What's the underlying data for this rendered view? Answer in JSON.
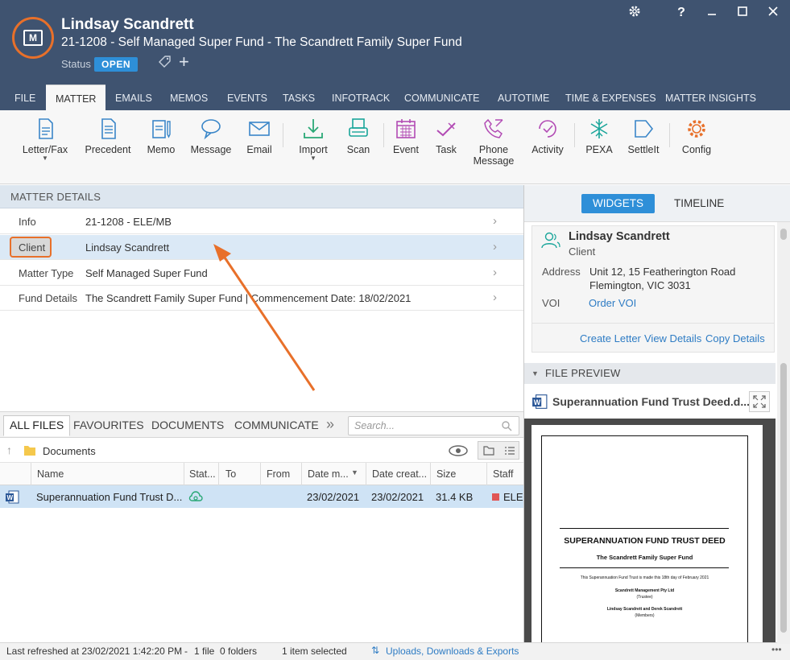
{
  "window": {
    "client_name": "Lindsay Scandrett",
    "matter_line": "21-1208 - Self Managed Super Fund - The Scandrett Family Super Fund",
    "status_label": "Status",
    "status_value": "OPEN",
    "logo_letter": "M",
    "controls": [
      "gear",
      "help",
      "minimize",
      "maximize",
      "close"
    ]
  },
  "tabs": [
    "FILE",
    "MATTER",
    "EMAILS",
    "MEMOS",
    "EVENTS",
    "TASKS",
    "INFOTRACK",
    "COMMUNICATE",
    "AUTOTIME",
    "TIME & EXPENSES",
    "MATTER INSIGHTS"
  ],
  "ribbon": {
    "letter_fax": "Letter/Fax",
    "precedent": "Precedent",
    "memo": "Memo",
    "message": "Message",
    "email": "Email",
    "import": "Import",
    "scan": "Scan",
    "event": "Event",
    "task": "Task",
    "phone_message_1": "Phone",
    "phone_message_2": "Message",
    "activity": "Activity",
    "pexa": "PEXA",
    "settleit": "SettleIt",
    "config": "Config"
  },
  "matter_details": {
    "header": "MATTER DETAILS",
    "rows": [
      {
        "label": "Info",
        "value": "21-1208 - ELE/MB"
      },
      {
        "label": "Client",
        "value": "Lindsay Scandrett"
      },
      {
        "label": "Matter Type",
        "value": "Self Managed Super Fund"
      },
      {
        "label": "Fund Details",
        "value": "The Scandrett Family Super Fund | Commencement Date: 18/02/2021"
      }
    ]
  },
  "files": {
    "tabs": [
      "ALL FILES",
      "FAVOURITES",
      "DOCUMENTS",
      "COMMUNICATE"
    ],
    "search_placeholder": "Search...",
    "folder": "Documents",
    "columns": [
      "Name",
      "Stat...",
      "To",
      "From",
      "Date m...",
      "Date creat...",
      "Size",
      "Staff"
    ],
    "rows": [
      {
        "name": "Superannuation Fund Trust D...",
        "to": "",
        "from": "",
        "date_modified": "23/02/2021",
        "date_created": "23/02/2021",
        "size": "31.4 KB",
        "staff": "ELE"
      }
    ]
  },
  "status_bar": {
    "refreshed": "Last refreshed at 23/02/2021 1:42:20 PM",
    "sep": "-",
    "file_count": "1 file",
    "folder_count": "0 folders",
    "selected": "1 item selected",
    "uploads": "Uploads, Downloads & Exports"
  },
  "right_panel": {
    "tab_widgets": "WIDGETS",
    "tab_timeline": "TIMELINE",
    "contact_name": "Lindsay Scandrett",
    "contact_role": "Client",
    "address_label": "Address",
    "address_line1": "Unit 12, 15 Featherington Road",
    "address_line2": "Flemington, VIC 3031",
    "voi_label": "VOI",
    "voi_link": "Order VOI",
    "create_letter": "Create Letter",
    "view_details": "View Details",
    "copy_details": "Copy Details",
    "file_preview_header": "FILE PREVIEW",
    "preview_file_name": "Superannuation Fund Trust Deed.d...",
    "doc_title": "SUPERANNUATION FUND TRUST DEED",
    "doc_subtitle": "The Scandrett Family Super Fund",
    "doc_line1": "This Superannuation Fund Trust is made this 18th day of February 2021",
    "doc_line2": "Scandrett Management Pty Ltd",
    "doc_line3": "(Trustee)",
    "doc_line4": "Lindsay Scandrett and Derek Scandrett",
    "doc_line5": "(Members)"
  },
  "colors": {
    "titlebar": "#3f5370",
    "accent_orange": "#e8702a",
    "accent_blue": "#2e8fd8",
    "ribbon_blue": "#3a86c8",
    "ribbon_purple": "#b24bb4",
    "ribbon_teal": "#19a59a"
  }
}
